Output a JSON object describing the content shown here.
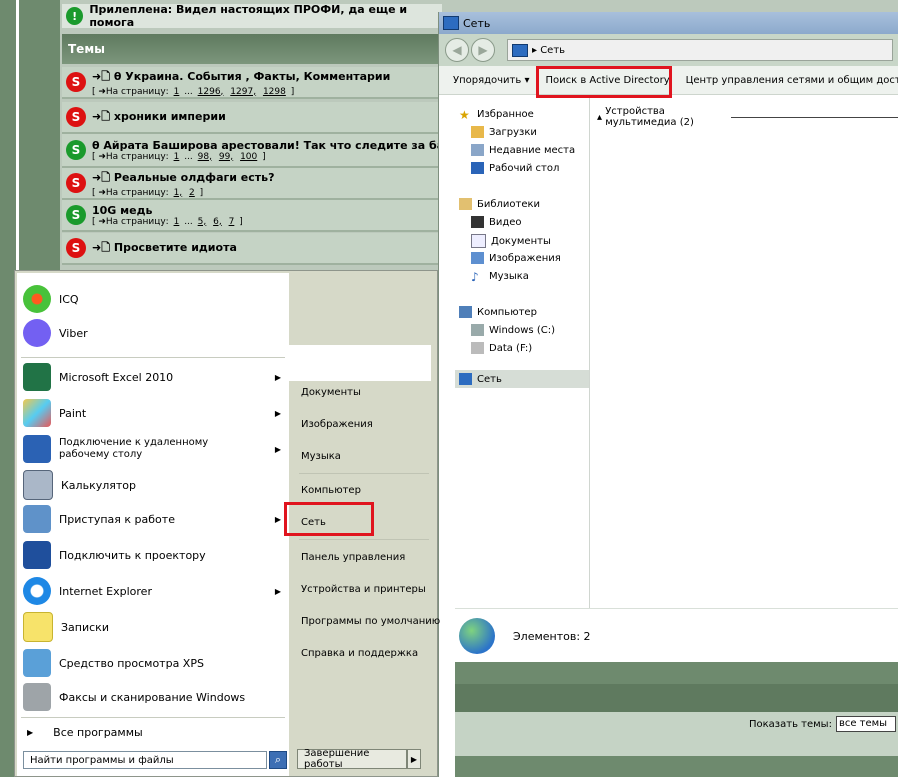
{
  "forum": {
    "pinned": "Прилеплена: Видел настоящих ПРОФИ, да еще и помога",
    "topics_header": "Темы",
    "pages_prefix": "[ ➜На страницу:",
    "topics": [
      {
        "title": "➜🗋 θ Украина. События , Факты, Комментарии",
        "pages": [
          "1",
          "...",
          "1296,",
          "1297,",
          "1298"
        ],
        "state": "red"
      },
      {
        "title": "➜🗋 хроники империи",
        "pages": [],
        "state": "red"
      },
      {
        "title": "θ Айрата Баширова арестовали! Так что следите за баз",
        "pages": [
          "1",
          "...",
          "98,",
          "99,",
          "100"
        ],
        "state": "green"
      },
      {
        "title": "➜🗋 Реальные олдфаги есть?",
        "pages": [
          "1,",
          "2"
        ],
        "state": "red"
      },
      {
        "title": "10G медь",
        "pages": [
          "1",
          "...",
          "5,",
          "6,",
          "7"
        ],
        "state": "green"
      },
      {
        "title": "➜🗋 Просветите идиота",
        "pages": [],
        "state": "red"
      }
    ],
    "show_topics_label": "Показать темы:",
    "show_topics_value": "все темы"
  },
  "explorer": {
    "title": "Сеть",
    "address": "▸ Сеть",
    "toolbar": {
      "organize": "Упорядочить",
      "search_ad": "Поиск в Active Directory",
      "network_center": "Центр управления сетями и общим доступом"
    },
    "nav": {
      "favorites": "Избранное",
      "downloads": "Загрузки",
      "recent": "Недавние места",
      "desktop": "Рабочий стол",
      "libraries": "Библиотеки",
      "video": "Видео",
      "documents": "Документы",
      "images": "Изображения",
      "music": "Музыка",
      "computer": "Компьютер",
      "drive_c": "Windows (C:)",
      "drive_f": "Data (F:)",
      "network": "Сеть"
    },
    "group_header": "Устройства мультимедиа (2)",
    "status": "Элементов: 2"
  },
  "start_menu": {
    "programs": [
      {
        "label": "ICQ"
      },
      {
        "label": "Viber"
      },
      {
        "label": "Microsoft Excel 2010"
      },
      {
        "label": "Paint"
      },
      {
        "label": "Подключение к удаленному рабочему столу"
      },
      {
        "label": "Калькулятор"
      },
      {
        "label": "Приступая к работе"
      },
      {
        "label": "Подключить к проектору"
      },
      {
        "label": "Internet Explorer"
      },
      {
        "label": "Записки"
      },
      {
        "label": "Средство просмотра XPS"
      },
      {
        "label": "Факсы и сканирование Windows"
      }
    ],
    "all_programs": "Все программы",
    "search_placeholder": "Найти программы и файлы",
    "right": {
      "documents": "Документы",
      "images": "Изображения",
      "music": "Музыка",
      "computer": "Компьютер",
      "network": "Сеть",
      "control_panel": "Панель управления",
      "devices": "Устройства и принтеры",
      "defaults": "Программы по умолчанию",
      "help": "Справка и поддержка"
    },
    "shutdown": "Завершение работы"
  },
  "colors": {
    "highlight": "#e0141e",
    "forum_green": "#6e8a6e"
  }
}
